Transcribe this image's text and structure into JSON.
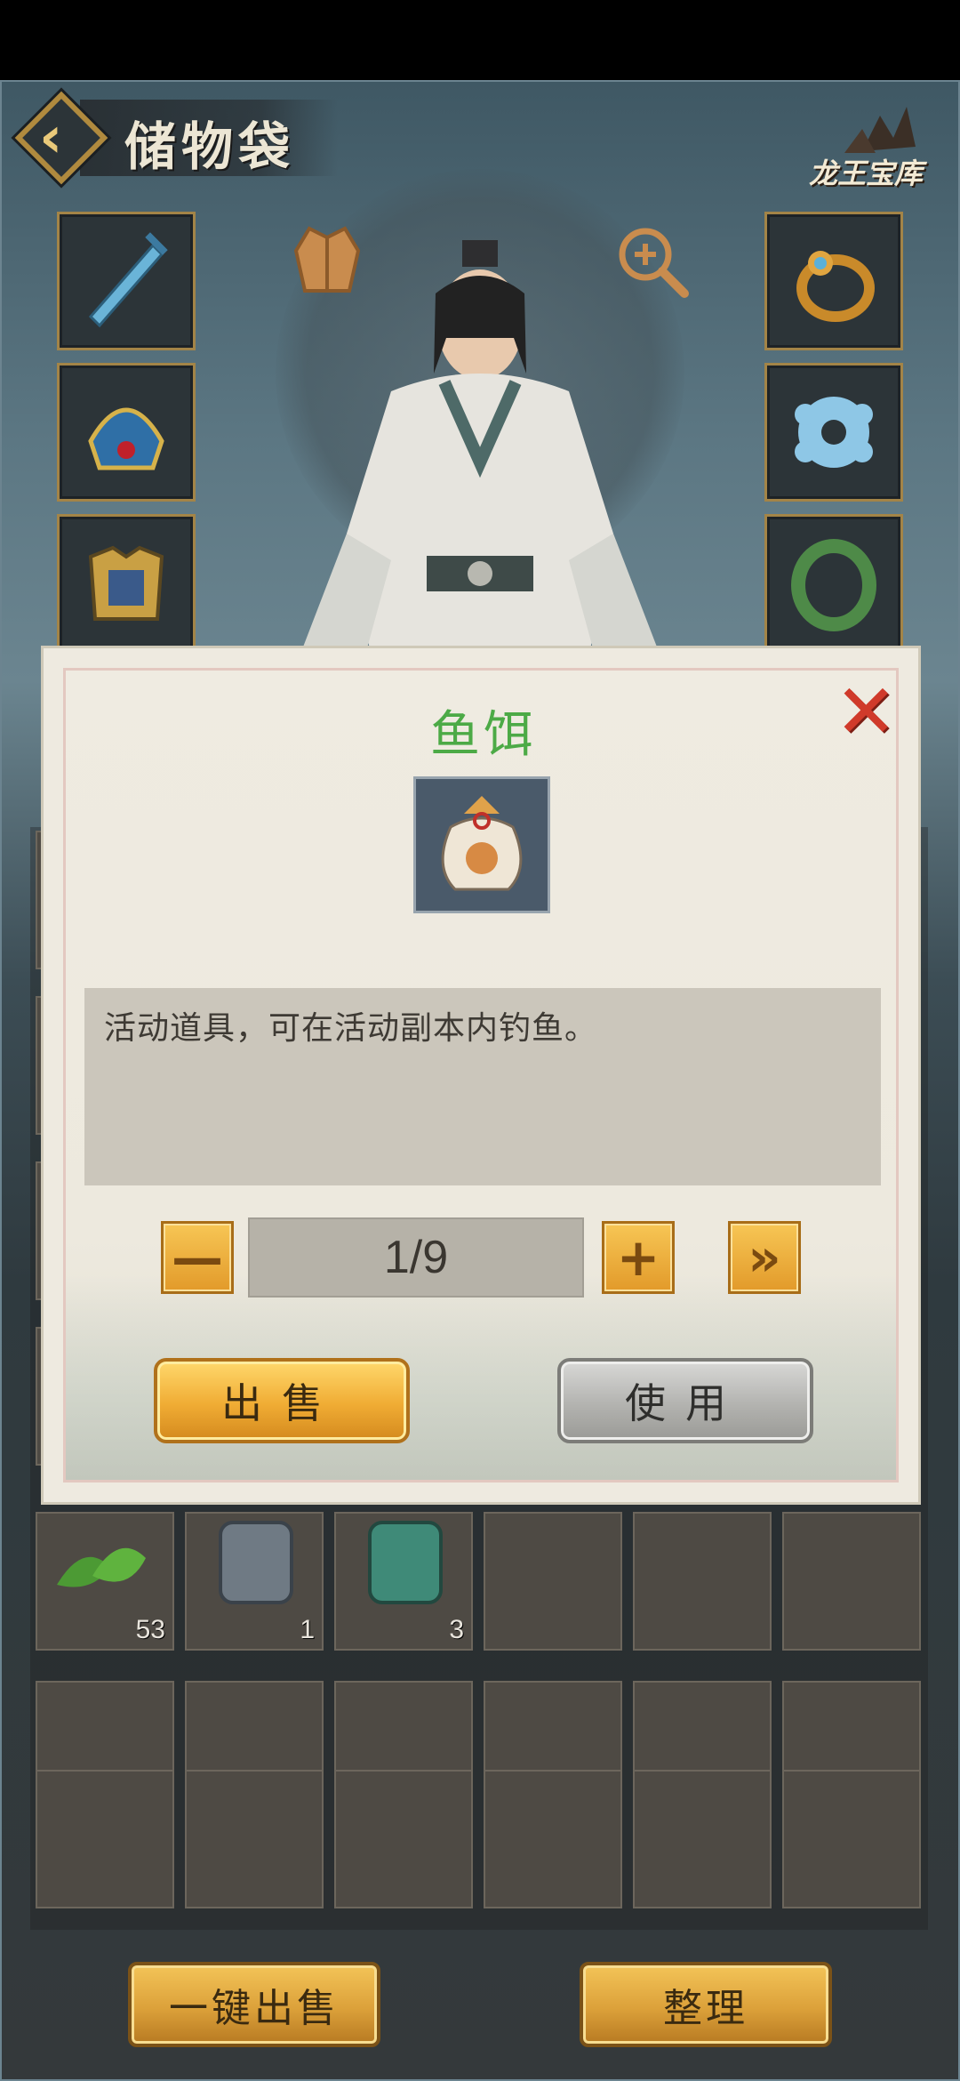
{
  "header": {
    "title": "储物袋",
    "treasury_label": "龙王宝库"
  },
  "dialog": {
    "item_name": "鱼饵",
    "item_name_color": "#4caa46",
    "description": "活动道具，可在活动副本内钓鱼。",
    "quantity": "1/9",
    "sell_label": "出售",
    "use_label": "使用",
    "decrement_label": "—",
    "increment_label": "+",
    "max_label": "»",
    "close_label": "✕"
  },
  "inventory": {
    "visible_counts": [
      "53",
      "1",
      "3"
    ]
  },
  "footer": {
    "sell_all_label": "一键出售",
    "sort_label": "整理"
  },
  "icons": {
    "equipment_left": [
      "sword-icon",
      "helmet-icon",
      "armor-icon"
    ],
    "equipment_right": [
      "ring-icon",
      "amulet-icon",
      "bracelet-icon"
    ]
  }
}
